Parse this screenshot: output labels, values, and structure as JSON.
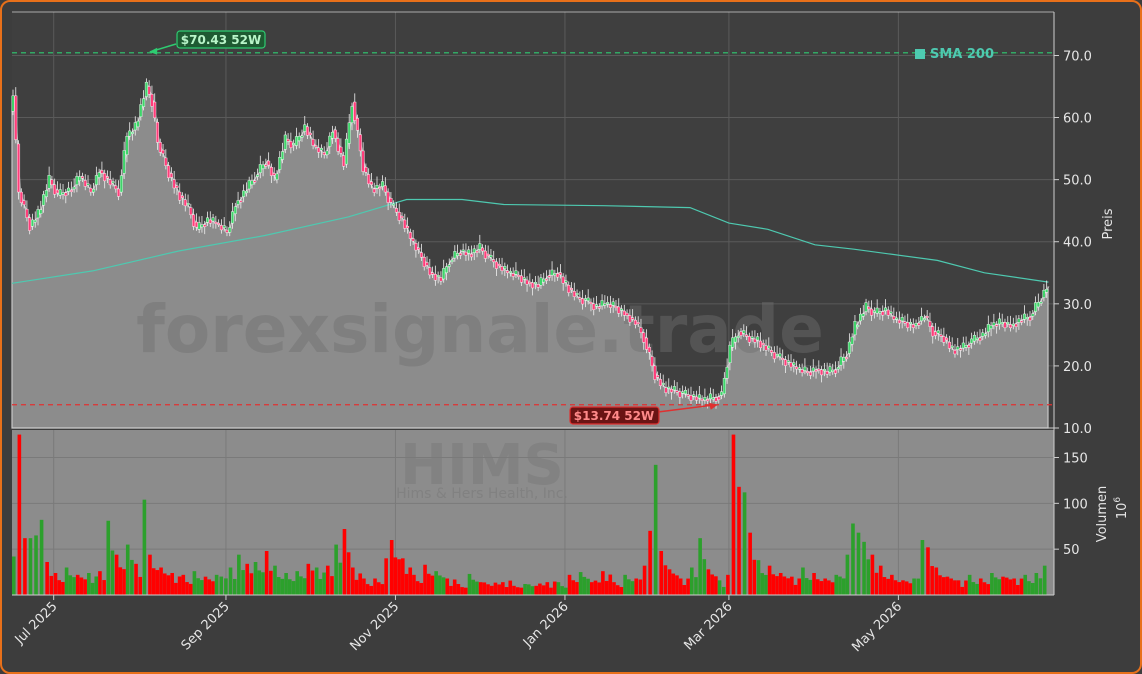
{
  "chart_data": {
    "type": "candlestick",
    "ticker": "HIMS",
    "company": "Hims & Hers Health, Inc.",
    "watermark": "forexsignale.trade",
    "y_label": "Preis",
    "y_ticks": [
      "10.0",
      "20.0",
      "30.0",
      "40.0",
      "50.0",
      "60.0",
      "70.0"
    ],
    "ylim": [
      10,
      77
    ],
    "volume_label": "Volumen",
    "volume_unit": "10",
    "volume_exponent": "6",
    "volume_ticks": [
      "50",
      "100",
      "150"
    ],
    "volume_ylim": [
      0,
      180
    ],
    "x_ticks": [
      "Jul 2025",
      "Sep 2025",
      "Nov 2025",
      "Jan 2026",
      "Mar 2026",
      "May 2026"
    ],
    "x_tick_dates": [
      "2025-07-01",
      "2025-09-01",
      "2025-11-01",
      "2026-01-01",
      "2026-03-01",
      "2026-05-01"
    ],
    "x_range": [
      "2025-06-16",
      "2026-06-26"
    ],
    "legend": {
      "label": "SMA 200",
      "color": "#4ec9b0",
      "placement": "top-right"
    },
    "high_52w": {
      "label": "$70.43 52W",
      "value": 70.43,
      "date": "2025-08-04"
    },
    "low_52w": {
      "label": "$13.74 52W",
      "value": 13.74,
      "date": "2026-02-25"
    },
    "last_price": 32.7,
    "colors": {
      "up": "#2ca02c",
      "down": "#ff0000",
      "sma": "#4ec9b0",
      "high": "#2ecc71",
      "low": "#e03030",
      "area": "#8c8c8c"
    },
    "price_points": [
      [
        "2025-06-16",
        61.0
      ],
      [
        "2025-06-17",
        63.5
      ],
      [
        "2025-06-19",
        48.0
      ],
      [
        "2025-06-23",
        42.5
      ],
      [
        "2025-06-26",
        44.5
      ],
      [
        "2025-06-30",
        50.0
      ],
      [
        "2025-07-03",
        47.5
      ],
      [
        "2025-07-08",
        48.5
      ],
      [
        "2025-07-11",
        50.5
      ],
      [
        "2025-07-15",
        48.0
      ],
      [
        "2025-07-18",
        51.5
      ],
      [
        "2025-07-22",
        49.5
      ],
      [
        "2025-07-25",
        48.0
      ],
      [
        "2025-07-28",
        57.0
      ],
      [
        "2025-07-31",
        58.5
      ],
      [
        "2025-08-04",
        65.0
      ],
      [
        "2025-08-06",
        62.5
      ],
      [
        "2025-08-08",
        56.0
      ],
      [
        "2025-08-12",
        51.0
      ],
      [
        "2025-08-15",
        48.0
      ],
      [
        "2025-08-19",
        45.5
      ],
      [
        "2025-08-22",
        42.0
      ],
      [
        "2025-08-26",
        43.5
      ],
      [
        "2025-08-29",
        43.0
      ],
      [
        "2025-09-02",
        41.5
      ],
      [
        "2025-09-05",
        46.0
      ],
      [
        "2025-09-09",
        48.5
      ],
      [
        "2025-09-12",
        50.5
      ],
      [
        "2025-09-16",
        53.0
      ],
      [
        "2025-09-19",
        50.0
      ],
      [
        "2025-09-23",
        56.5
      ],
      [
        "2025-09-26",
        55.5
      ],
      [
        "2025-09-30",
        58.5
      ],
      [
        "2025-10-03",
        55.5
      ],
      [
        "2025-10-07",
        54.0
      ],
      [
        "2025-10-10",
        58.0
      ],
      [
        "2025-10-14",
        52.5
      ],
      [
        "2025-10-17",
        62.5
      ],
      [
        "2025-10-21",
        52.0
      ],
      [
        "2025-10-24",
        48.5
      ],
      [
        "2025-10-28",
        49.0
      ],
      [
        "2025-10-31",
        46.0
      ],
      [
        "2025-11-04",
        43.5
      ],
      [
        "2025-11-07",
        40.5
      ],
      [
        "2025-11-11",
        37.5
      ],
      [
        "2025-11-14",
        35.0
      ],
      [
        "2025-11-18",
        34.0
      ],
      [
        "2025-11-21",
        37.0
      ],
      [
        "2025-11-25",
        38.5
      ],
      [
        "2025-11-28",
        38.0
      ],
      [
        "2025-12-02",
        39.0
      ],
      [
        "2025-12-05",
        37.5
      ],
      [
        "2025-12-09",
        36.0
      ],
      [
        "2025-12-12",
        35.0
      ],
      [
        "2025-12-16",
        34.5
      ],
      [
        "2025-12-19",
        33.5
      ],
      [
        "2025-12-23",
        33.0
      ],
      [
        "2025-12-26",
        34.5
      ],
      [
        "2025-12-30",
        35.0
      ],
      [
        "2026-01-02",
        33.0
      ],
      [
        "2026-01-06",
        31.0
      ],
      [
        "2026-01-09",
        30.5
      ],
      [
        "2026-01-13",
        29.5
      ],
      [
        "2026-01-16",
        30.0
      ],
      [
        "2026-01-20",
        29.5
      ],
      [
        "2026-01-23",
        28.5
      ],
      [
        "2026-01-27",
        27.0
      ],
      [
        "2026-01-30",
        24.5
      ],
      [
        "2026-02-03",
        18.5
      ],
      [
        "2026-02-06",
        16.5
      ],
      [
        "2026-02-10",
        16.0
      ],
      [
        "2026-02-13",
        15.5
      ],
      [
        "2026-02-17",
        15.0
      ],
      [
        "2026-02-20",
        14.5
      ],
      [
        "2026-02-25",
        15.0
      ],
      [
        "2026-02-27",
        15.5
      ],
      [
        "2026-03-02",
        23.0
      ],
      [
        "2026-03-05",
        25.5
      ],
      [
        "2026-03-09",
        24.5
      ],
      [
        "2026-03-12",
        24.0
      ],
      [
        "2026-03-16",
        22.5
      ],
      [
        "2026-03-19",
        21.5
      ],
      [
        "2026-03-23",
        20.5
      ],
      [
        "2026-03-26",
        19.5
      ],
      [
        "2026-03-30",
        19.0
      ],
      [
        "2026-04-02",
        19.5
      ],
      [
        "2026-04-06",
        19.0
      ],
      [
        "2026-04-09",
        19.5
      ],
      [
        "2026-04-13",
        22.0
      ],
      [
        "2026-04-16",
        26.5
      ],
      [
        "2026-04-20",
        29.5
      ],
      [
        "2026-04-23",
        28.5
      ],
      [
        "2026-04-27",
        29.0
      ],
      [
        "2026-04-30",
        27.5
      ],
      [
        "2026-05-04",
        27.0
      ],
      [
        "2026-05-07",
        26.5
      ],
      [
        "2026-05-11",
        28.0
      ],
      [
        "2026-05-14",
        25.5
      ],
      [
        "2026-05-18",
        24.5
      ],
      [
        "2026-05-21",
        22.5
      ],
      [
        "2026-05-25",
        23.0
      ],
      [
        "2026-05-28",
        24.0
      ],
      [
        "2026-06-01",
        25.0
      ],
      [
        "2026-06-04",
        26.5
      ],
      [
        "2026-06-08",
        27.0
      ],
      [
        "2026-06-11",
        26.5
      ],
      [
        "2026-06-15",
        27.5
      ],
      [
        "2026-06-18",
        28.0
      ],
      [
        "2026-06-22",
        31.0
      ],
      [
        "2026-06-24",
        32.7
      ]
    ],
    "sma_200": [
      [
        "2025-06-16",
        33.3
      ],
      [
        "2025-07-15",
        35.3
      ],
      [
        "2025-08-15",
        38.5
      ],
      [
        "2025-09-15",
        41.0
      ],
      [
        "2025-10-15",
        44.0
      ],
      [
        "2025-11-05",
        46.8
      ],
      [
        "2025-11-25",
        46.8
      ],
      [
        "2025-12-10",
        46.0
      ],
      [
        "2026-01-15",
        45.8
      ],
      [
        "2026-02-15",
        45.5
      ],
      [
        "2026-03-01",
        43.0
      ],
      [
        "2026-03-15",
        42.0
      ],
      [
        "2026-04-01",
        39.5
      ],
      [
        "2026-04-15",
        38.8
      ],
      [
        "2026-05-15",
        37.0
      ],
      [
        "2026-06-01",
        35.0
      ],
      [
        "2026-06-24",
        33.5
      ]
    ],
    "volume_points": [
      [
        "2025-06-16",
        42,
        "up"
      ],
      [
        "2025-06-18",
        175,
        "down"
      ],
      [
        "2025-06-20",
        62,
        "down"
      ],
      [
        "2025-06-22",
        62,
        "up"
      ],
      [
        "2025-06-24",
        65,
        "up"
      ],
      [
        "2025-06-26",
        82,
        "up"
      ],
      [
        "2025-06-28",
        36,
        "down"
      ],
      [
        "2025-07-01",
        24,
        "down"
      ],
      [
        "2025-07-05",
        30,
        "up"
      ],
      [
        "2025-07-09",
        22,
        "down"
      ],
      [
        "2025-07-13",
        24,
        "up"
      ],
      [
        "2025-07-17",
        26,
        "down"
      ],
      [
        "2025-07-20",
        81,
        "up"
      ],
      [
        "2025-07-23",
        44,
        "down"
      ],
      [
        "2025-07-27",
        55,
        "up"
      ],
      [
        "2025-07-30",
        34,
        "down"
      ],
      [
        "2025-08-02",
        104,
        "up"
      ],
      [
        "2025-08-04",
        44,
        "down"
      ],
      [
        "2025-08-08",
        30,
        "down"
      ],
      [
        "2025-08-12",
        24,
        "down"
      ],
      [
        "2025-08-16",
        22,
        "down"
      ],
      [
        "2025-08-20",
        26,
        "up"
      ],
      [
        "2025-08-24",
        20,
        "down"
      ],
      [
        "2025-08-28",
        22,
        "up"
      ],
      [
        "2025-09-02",
        30,
        "up"
      ],
      [
        "2025-09-05",
        44,
        "up"
      ],
      [
        "2025-09-08",
        34,
        "down"
      ],
      [
        "2025-09-11",
        36,
        "up"
      ],
      [
        "2025-09-15",
        48,
        "down"
      ],
      [
        "2025-09-18",
        32,
        "up"
      ],
      [
        "2025-09-22",
        24,
        "up"
      ],
      [
        "2025-09-26",
        26,
        "up"
      ],
      [
        "2025-09-30",
        34,
        "down"
      ],
      [
        "2025-10-03",
        30,
        "up"
      ],
      [
        "2025-10-07",
        32,
        "down"
      ],
      [
        "2025-10-10",
        55,
        "up"
      ],
      [
        "2025-10-13",
        72,
        "down"
      ],
      [
        "2025-10-16",
        30,
        "down"
      ],
      [
        "2025-10-20",
        18,
        "down"
      ],
      [
        "2025-10-24",
        18,
        "down"
      ],
      [
        "2025-10-28",
        40,
        "down"
      ],
      [
        "2025-10-30",
        60,
        "down"
      ],
      [
        "2025-11-03",
        40,
        "down"
      ],
      [
        "2025-11-07",
        22,
        "down"
      ],
      [
        "2025-11-11",
        33,
        "down"
      ],
      [
        "2025-11-15",
        26,
        "up"
      ],
      [
        "2025-11-19",
        18,
        "down"
      ],
      [
        "2025-11-23",
        12,
        "down"
      ],
      [
        "2025-11-27",
        23,
        "up"
      ],
      [
        "2025-12-01",
        14,
        "down"
      ],
      [
        "2025-12-05",
        10,
        "down"
      ],
      [
        "2025-12-09",
        14,
        "down"
      ],
      [
        "2025-12-13",
        10,
        "down"
      ],
      [
        "2025-12-17",
        12,
        "up"
      ],
      [
        "2025-12-21",
        10,
        "down"
      ],
      [
        "2025-12-25",
        14,
        "down"
      ],
      [
        "2025-12-29",
        14,
        "up"
      ],
      [
        "2026-01-02",
        22,
        "down"
      ],
      [
        "2026-01-06",
        25,
        "up"
      ],
      [
        "2026-01-10",
        14,
        "down"
      ],
      [
        "2026-01-14",
        26,
        "down"
      ],
      [
        "2026-01-18",
        14,
        "down"
      ],
      [
        "2026-01-22",
        22,
        "up"
      ],
      [
        "2026-01-26",
        18,
        "down"
      ],
      [
        "2026-01-29",
        32,
        "down"
      ],
      [
        "2026-01-31",
        70,
        "down"
      ],
      [
        "2026-02-02",
        142,
        "up"
      ],
      [
        "2026-02-04",
        48,
        "down"
      ],
      [
        "2026-02-07",
        28,
        "down"
      ],
      [
        "2026-02-11",
        18,
        "down"
      ],
      [
        "2026-02-15",
        30,
        "up"
      ],
      [
        "2026-02-18",
        62,
        "up"
      ],
      [
        "2026-02-21",
        28,
        "down"
      ],
      [
        "2026-02-25",
        16,
        "up"
      ],
      [
        "2026-02-28",
        22,
        "down"
      ],
      [
        "2026-03-02",
        175,
        "down"
      ],
      [
        "2026-03-04",
        118,
        "down"
      ],
      [
        "2026-03-06",
        112,
        "up"
      ],
      [
        "2026-03-08",
        68,
        "down"
      ],
      [
        "2026-03-11",
        38,
        "up"
      ],
      [
        "2026-03-15",
        32,
        "down"
      ],
      [
        "2026-03-19",
        24,
        "down"
      ],
      [
        "2026-03-23",
        20,
        "down"
      ],
      [
        "2026-03-27",
        30,
        "up"
      ],
      [
        "2026-03-31",
        24,
        "down"
      ],
      [
        "2026-04-04",
        18,
        "down"
      ],
      [
        "2026-04-08",
        22,
        "up"
      ],
      [
        "2026-04-12",
        44,
        "up"
      ],
      [
        "2026-04-14",
        78,
        "up"
      ],
      [
        "2026-04-16",
        68,
        "up"
      ],
      [
        "2026-04-18",
        58,
        "up"
      ],
      [
        "2026-04-21",
        44,
        "down"
      ],
      [
        "2026-04-24",
        32,
        "down"
      ],
      [
        "2026-04-28",
        22,
        "down"
      ],
      [
        "2026-05-02",
        16,
        "down"
      ],
      [
        "2026-05-06",
        18,
        "up"
      ],
      [
        "2026-05-09",
        60,
        "up"
      ],
      [
        "2026-05-11",
        52,
        "down"
      ],
      [
        "2026-05-14",
        30,
        "down"
      ],
      [
        "2026-05-18",
        20,
        "down"
      ],
      [
        "2026-05-22",
        16,
        "down"
      ],
      [
        "2026-05-26",
        22,
        "up"
      ],
      [
        "2026-05-30",
        18,
        "down"
      ],
      [
        "2026-06-03",
        24,
        "up"
      ],
      [
        "2026-06-07",
        20,
        "down"
      ],
      [
        "2026-06-11",
        18,
        "down"
      ],
      [
        "2026-06-15",
        22,
        "up"
      ],
      [
        "2026-06-19",
        24,
        "up"
      ],
      [
        "2026-06-22",
        32,
        "up"
      ]
    ]
  }
}
